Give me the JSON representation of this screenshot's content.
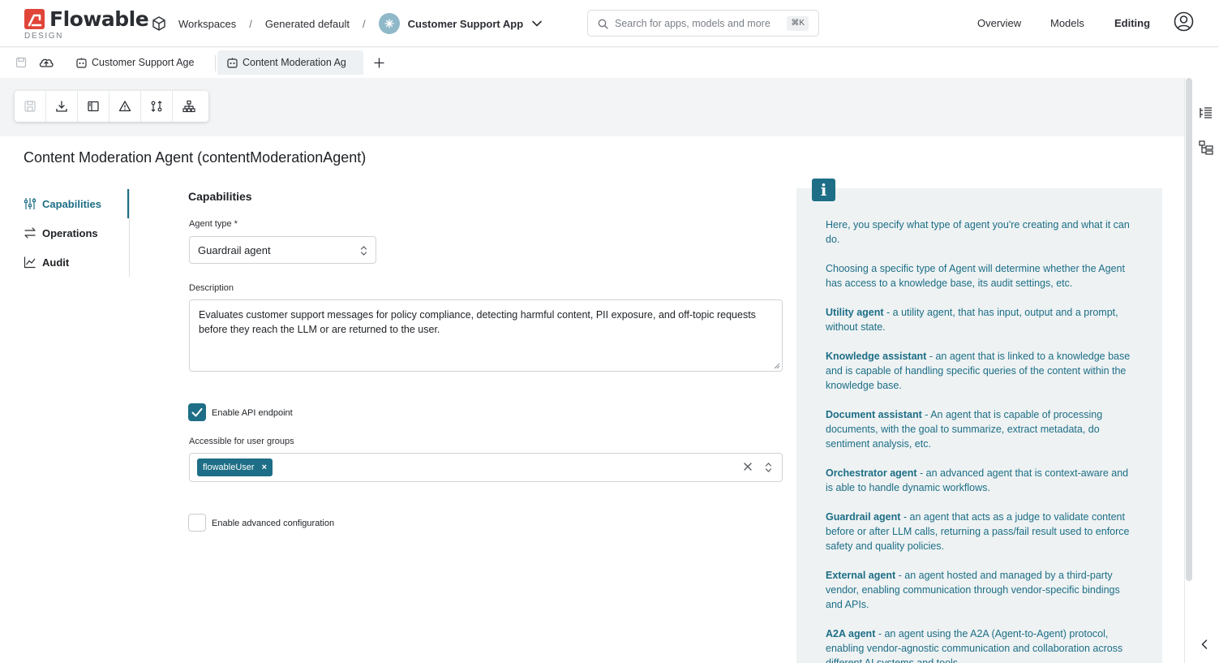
{
  "header": {
    "logo_text": "Flowable",
    "logo_sub": "DESIGN",
    "breadcrumbs": [
      "Workspaces",
      "Generated default",
      "Customer Support App"
    ],
    "search_placeholder": "Search for apps, models and more",
    "search_shortcut": "⌘K",
    "nav": [
      "Overview",
      "Models",
      "Editing"
    ],
    "active_nav": "Editing"
  },
  "tabs": [
    {
      "label": "Customer Support Age",
      "active": false
    },
    {
      "label": "Content Moderation Ag",
      "active": true
    }
  ],
  "toolbar_icons": [
    "save-icon",
    "download-icon",
    "panel-icon",
    "warning-icon",
    "compare-icon",
    "hierarchy-icon"
  ],
  "page": {
    "title": "Content Moderation Agent (contentModerationAgent)"
  },
  "leftnav": {
    "items": [
      {
        "label": "Capabilities",
        "active": true
      },
      {
        "label": "Operations",
        "active": false
      },
      {
        "label": "Audit",
        "active": false
      }
    ]
  },
  "form": {
    "section_title": "Capabilities",
    "agent_type_label": "Agent type *",
    "agent_type_value": "Guardrail agent",
    "description_label": "Description",
    "description_value": "Evaluates customer support messages for policy compliance, detecting harmful content, PII exposure, and off-topic requests before they reach the LLM or are returned to the user.",
    "enable_api_label": "Enable API endpoint",
    "enable_api_checked": true,
    "groups_label": "Accessible for user groups",
    "groups": [
      "flowableUser"
    ],
    "chip_remove": "×",
    "advanced_label": "Enable advanced configuration",
    "advanced_checked": false
  },
  "info": {
    "icon": "i",
    "intro1": "Here, you specify what type of agent you're creating and what it can do.",
    "intro2": "Choosing a specific type of Agent will determine whether the Agent has access to a knowledge base, its audit settings, etc.",
    "types": [
      {
        "name": "Utility agent",
        "desc": " - a utility agent, that has input, output and a prompt, without state."
      },
      {
        "name": "Knowledge assistant",
        "desc": " - an agent that is linked to a knowledge base and is capable of handling specific queries of the content within the knowledge base."
      },
      {
        "name": "Document assistant",
        "desc": " - An agent that is capable of processing documents, with the goal to summarize, extract metadata, do sentiment analysis, etc."
      },
      {
        "name": "Orchestrator agent",
        "desc": " - an advanced agent that is context-aware and is able to handle dynamic workflows."
      },
      {
        "name": "Guardrail agent",
        "desc": " - an agent that acts as a judge to validate content before or after LLM calls, returning a pass/fail result used to enforce safety and quality policies."
      },
      {
        "name": "External agent",
        "desc": " - an agent hosted and managed by a third-party vendor, enabling communication through vendor-specific bindings and APIs."
      },
      {
        "name": "A2A agent",
        "desc": " - an agent using the A2A (Agent-to-Agent) protocol, enabling vendor-agnostic communication and collaboration across different AI systems and tools."
      }
    ]
  },
  "colors": {
    "accent": "#1d6e86",
    "logo_red": "#e0453a",
    "info_bg": "#eef2f3"
  }
}
